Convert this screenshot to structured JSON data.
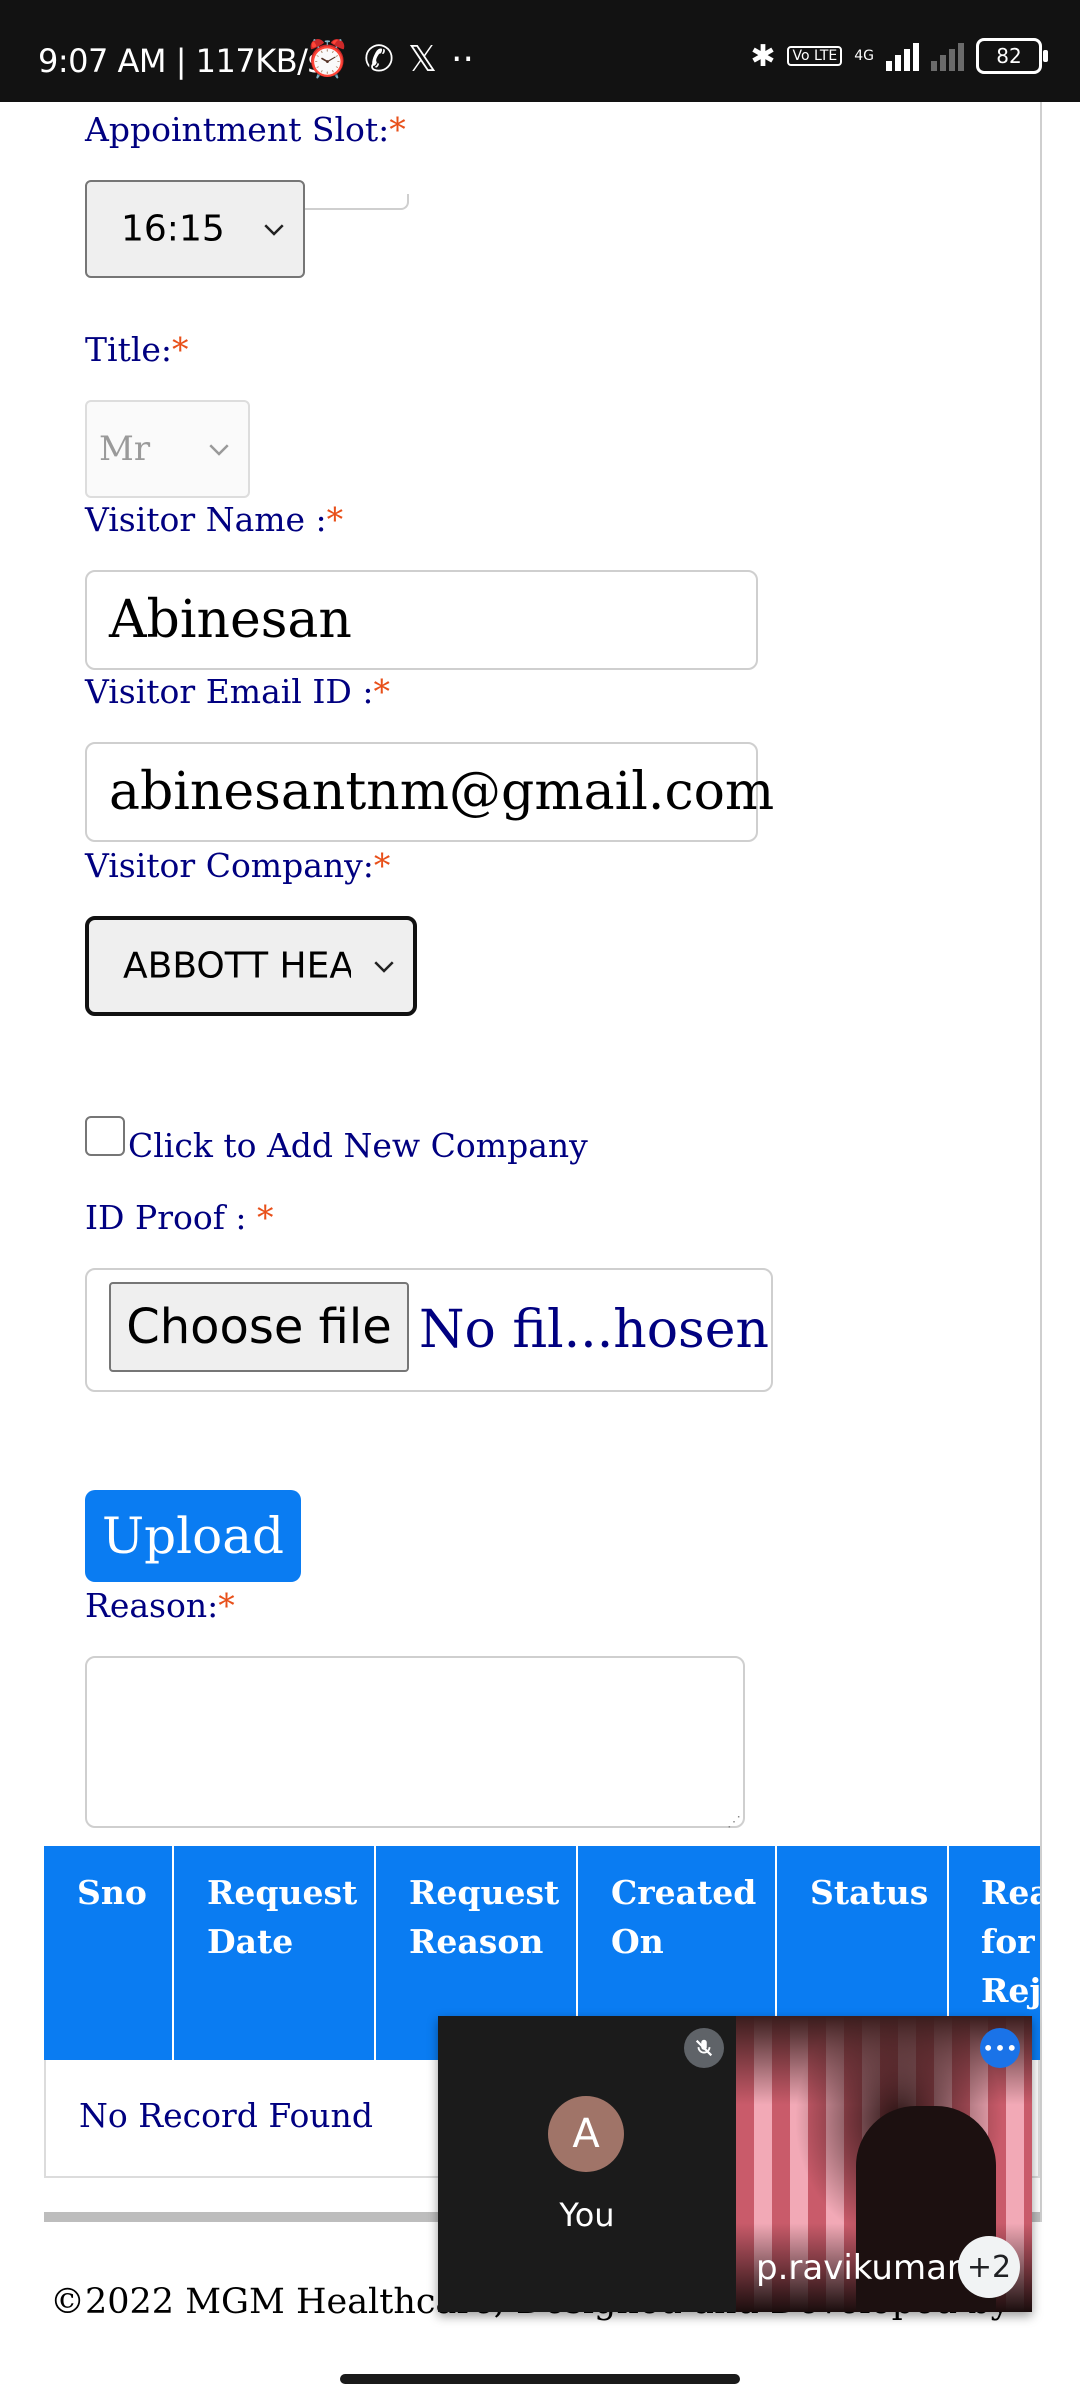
{
  "status_bar": {
    "time": "9:07 AM | 117KB/s",
    "battery": "82",
    "volte": "Vo LTE",
    "network": "4G"
  },
  "form": {
    "appointment_slot": {
      "label": "Appointment Slot:",
      "required": "*",
      "value": "16:15"
    },
    "title": {
      "label": "Title:",
      "required": "*",
      "value": "Mr"
    },
    "visitor_name": {
      "label": "Visitor Name :",
      "required": "*",
      "value": "Abinesan"
    },
    "visitor_email": {
      "label": "Visitor Email ID :",
      "required": "*",
      "value": "abinesantnm@gmail.com"
    },
    "visitor_company": {
      "label": "Visitor Company:",
      "required": "*",
      "value": "ABBOTT HEA"
    },
    "add_company": {
      "label": "Click to Add New Company"
    },
    "id_proof": {
      "label": "ID Proof : ",
      "required": "*",
      "button": "Choose file",
      "status": "No fil...hosen"
    },
    "upload_button": "Upload",
    "reason": {
      "label": "Reason:",
      "required": "*",
      "value": ""
    }
  },
  "table": {
    "headers": [
      "Sno",
      "Request Date",
      "Request Reason",
      "Created On",
      "Status",
      "Rea for Rej"
    ],
    "empty_message": "No Record Found"
  },
  "footer": {
    "text": "©2022 MGM Healthcare, Designed and Developed by"
  },
  "call_overlay": {
    "self_initial": "A",
    "self_label": "You",
    "remote_name": "p.ravikumar",
    "more_count": "+2"
  }
}
